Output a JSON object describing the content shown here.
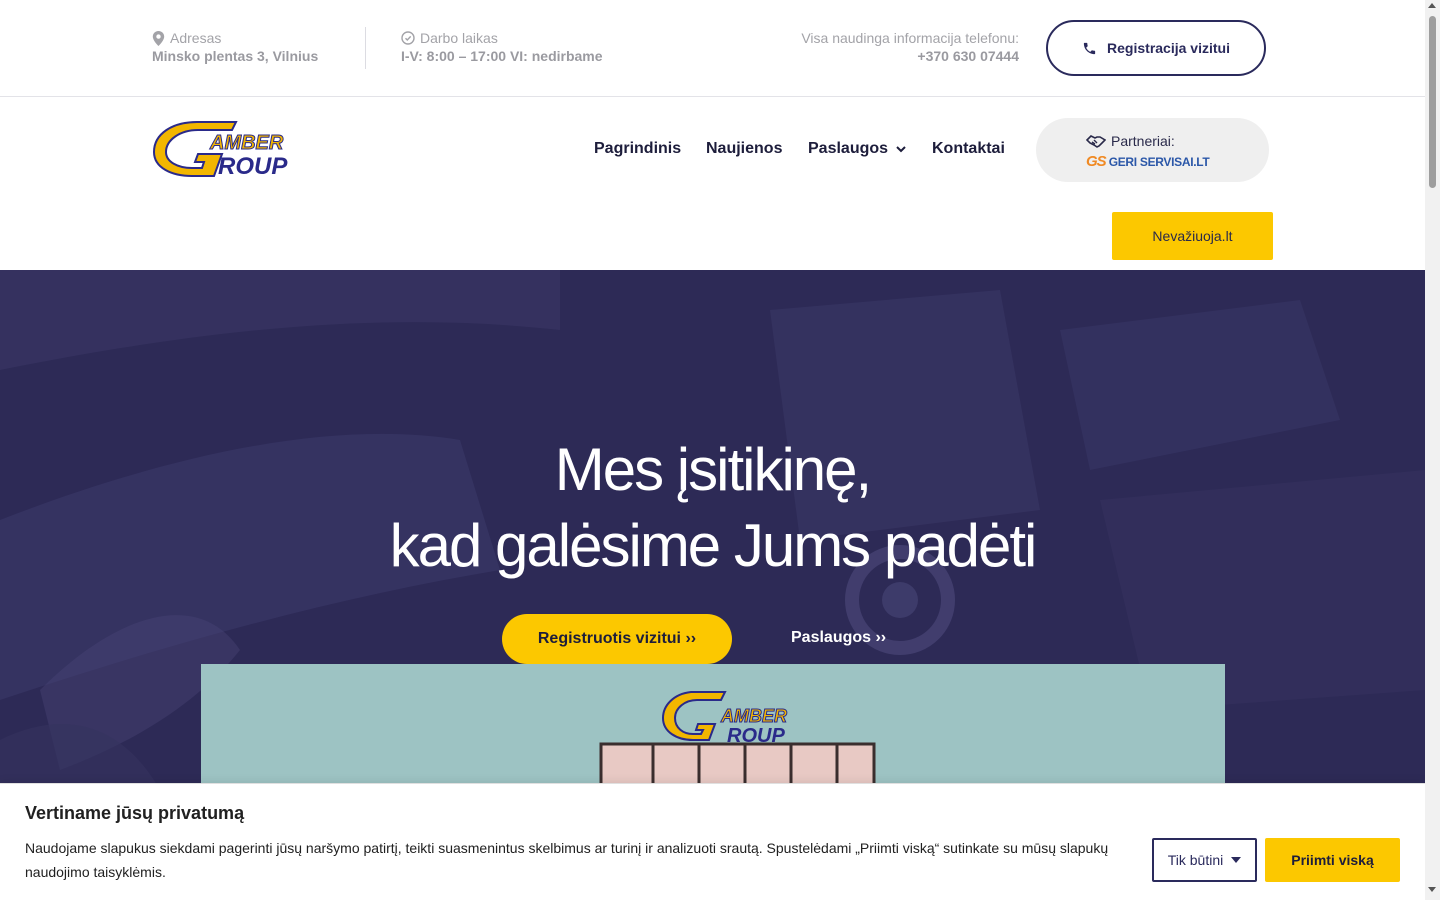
{
  "topbar": {
    "address_label": "Adresas",
    "address_value": "Minsko plentas 3, Vilnius",
    "hours_label": "Darbo laikas",
    "hours_value": "I-V: 8:00 – 17:00 VI: nedirbame",
    "phone_label": "Visa naudinga informacija telefonu:",
    "phone_value": "+370 630 07444",
    "register_button": "Registracija vizitui"
  },
  "header": {
    "logo_icon": "amber-group-logo",
    "logo_text_top": "AMBER",
    "logo_text_bottom": "ROUP",
    "nav": [
      "Pagrindinis",
      "Naujienos",
      "Paslaugos",
      "Kontaktai"
    ],
    "partners_label": "Partneriai:",
    "partners_logo_text": "GERI SERVISAI.LT",
    "partners_logo_mark": "GS",
    "nevaziuoja_button": "Nevažiuoja.lt"
  },
  "hero": {
    "title_line1": "Mes įsitikinę,",
    "title_line2": "kad galėsime Jums padėti",
    "primary_button": "Registruotis vizitui ››",
    "secondary_link": "Paslaugos ››",
    "photo_logo_top": "AMBER",
    "photo_logo_bottom": "ROUP"
  },
  "cookie": {
    "title": "Vertiname jūsų privatumą",
    "text": "Naudojame slapukus siekdami pagerinti jūsų naršymo patirtį, teikti suasmenintus skelbimus ar turinį ir analizuoti srautą. Spustelėdami „Priimti viską“ sutinkate su mūsų slapukų naudojimo taisyklėmis.",
    "necessary_button": "Tik būtini",
    "accept_button": "Priimti viską"
  },
  "colors": {
    "brand_navy": "#2a2a5c",
    "brand_yellow": "#fcc800",
    "hero_bg": "#2d2a56"
  }
}
